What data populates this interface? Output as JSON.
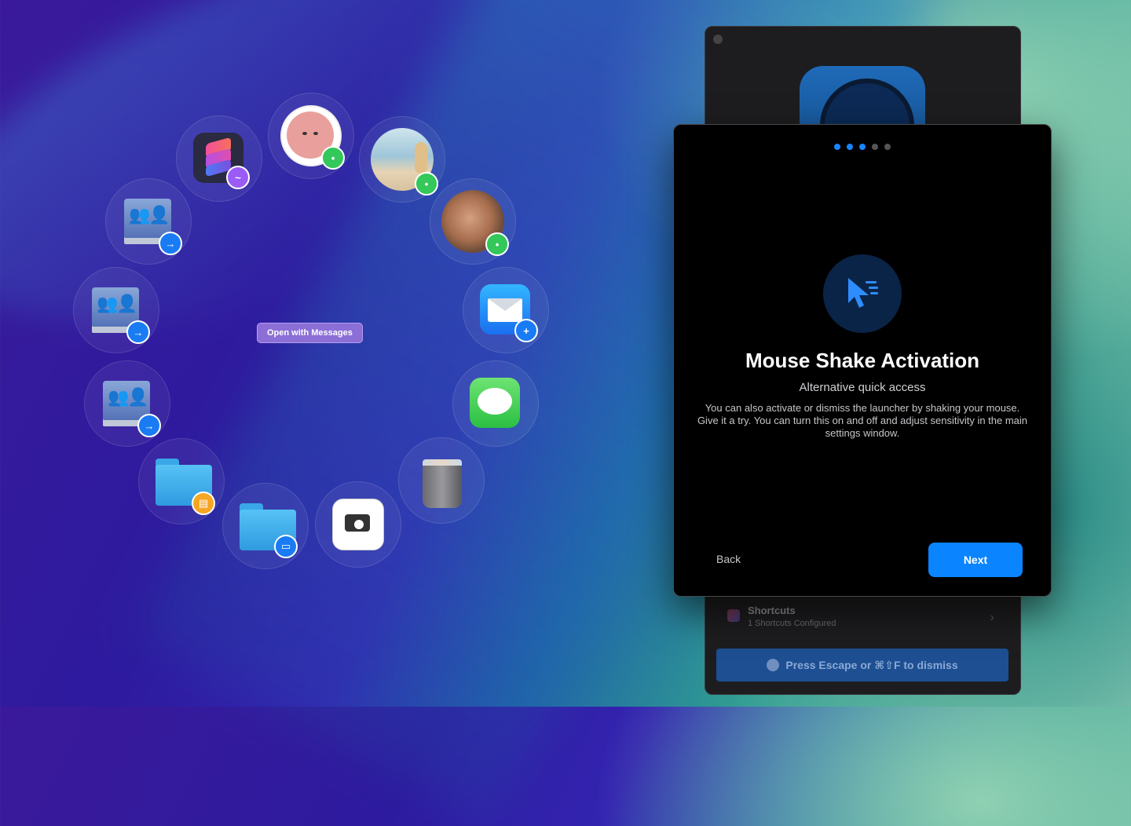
{
  "launcher": {
    "tooltip": "Open with Messages",
    "items": [
      {
        "name": "shortcuts-app",
        "badge": "messenger"
      },
      {
        "name": "contact-cartoon",
        "badge": "messages"
      },
      {
        "name": "contact-beach",
        "badge": "messages"
      },
      {
        "name": "contact-man",
        "badge": "messages"
      },
      {
        "name": "mail-app",
        "badge": "add"
      },
      {
        "name": "messages-app",
        "badge": ""
      },
      {
        "name": "trash",
        "badge": ""
      },
      {
        "name": "screenshot-app",
        "badge": ""
      },
      {
        "name": "desktop-folder",
        "badge": "display"
      },
      {
        "name": "documents-folder",
        "badge": "documents"
      },
      {
        "name": "network-drive-3",
        "badge": "go"
      },
      {
        "name": "network-drive-2",
        "badge": "go"
      },
      {
        "name": "network-drive-1",
        "badge": "go"
      }
    ]
  },
  "settings_window": {
    "shortcuts_title": "Shortcuts",
    "shortcuts_subtitle": "1 Shortcuts Configured",
    "dismiss_label": "Press Escape or ⌘⇧F to dismiss"
  },
  "onboarding": {
    "step": 3,
    "total_steps": 5,
    "title": "Mouse Shake Activation",
    "subtitle": "Alternative quick access",
    "description": "You can also activate or dismiss the launcher by shaking your mouse. Give it a try. You can turn this on and off and adjust sensitivity in the main settings window.",
    "back_label": "Back",
    "next_label": "Next",
    "accent_color": "#0a84ff"
  }
}
